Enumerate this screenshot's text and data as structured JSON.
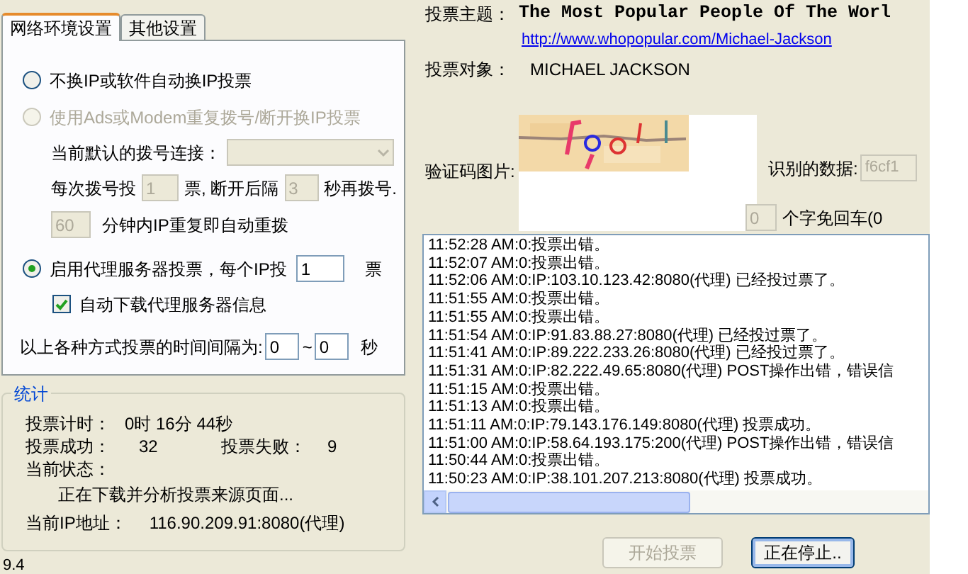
{
  "tabs": [
    {
      "label": "网络环境设置",
      "selected": true
    },
    {
      "label": "其他设置",
      "selected": false
    }
  ],
  "no_change_ip": {
    "label": "不换IP或软件自动换IP投票",
    "selected": false,
    "disabled": false
  },
  "dialup": {
    "label": "使用Ads或Modem重复拨号/断开换IP投票",
    "selected": false,
    "disabled": true,
    "connection_label": "当前默认的拨号连接：",
    "votes_label": "每次拨号投",
    "votes_value": "1",
    "interval_label": "票, 断开后隔",
    "interval_value": "3",
    "redial_label": "秒再拨号.",
    "minutes_value": "60",
    "minutes_label": "分钟内IP重复即自动重拨"
  },
  "proxy": {
    "label": "启用代理服务器投票，每个IP投",
    "selected": true,
    "disabled": false,
    "votes_value": "1",
    "votes_unit": "票",
    "auto_download": {
      "label": "自动下载代理服务器信息",
      "checked": true
    }
  },
  "interval": {
    "label": "以上各种方式投票的时间间隔为:",
    "from": "0",
    "separator": "~",
    "to": "0",
    "unit": "秒"
  },
  "stats": {
    "title": "统计",
    "timer_label": "投票计时：",
    "timer_value": "0时 16分 44秒",
    "success_label": "投票成功：",
    "success_value": "32",
    "fail_label": "投票失败：",
    "fail_value": "9",
    "status_label": "当前状态：",
    "status_value": "正在下载并分析投票来源页面...",
    "ip_label": "当前IP地址：",
    "ip_value": "116.90.209.91:8080(代理)"
  },
  "footer_text": "9.4",
  "topic": {
    "label": "投票主题：",
    "value": "The Most Popular People Of The Worl",
    "url": "http://www.whopopular.com/Michael-Jackson"
  },
  "target": {
    "label": "投票对象：",
    "value": "MICHAEL JACKSON"
  },
  "captcha": {
    "label": "验证码图片:",
    "recognized_label": "识别的数据:",
    "recognized_value": "f6cf1",
    "count_value": "0",
    "count_label": "个字免回车(0"
  },
  "log": [
    "11:52:28 AM:0:投票出错。",
    "11:52:07 AM:0:投票出错。",
    "11:52:06 AM:0:IP:103.10.123.42:8080(代理) 已经投过票了。",
    "11:51:55 AM:0:投票出错。",
    "11:51:55 AM:0:投票出错。",
    "11:51:54 AM:0:IP:91.83.88.27:8080(代理) 已经投过票了。",
    "11:51:41 AM:0:IP:89.222.233.26:8080(代理) 已经投过票了。",
    "11:51:31 AM:0:IP:82.222.49.65:8080(代理) POST操作出错，错误信",
    "11:51:15 AM:0:投票出错。",
    "11:51:13 AM:0:投票出错。",
    "11:51:11 AM:0:IP:79.143.176.149:8080(代理) 投票成功。",
    "11:51:00 AM:0:IP:58.64.193.175:200(代理) POST操作出错，错误信",
    "11:50:44 AM:0:投票出错。",
    "11:50:23 AM:0:IP:38.101.207.213:8080(代理) 投票成功。"
  ],
  "buttons": [
    {
      "label": "开始投票",
      "disabled": true
    },
    {
      "label": "正在停止..",
      "disabled": false
    }
  ]
}
